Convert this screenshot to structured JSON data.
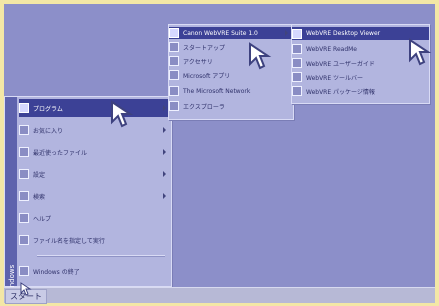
{
  "taskbar": {
    "start_label": "スタート"
  },
  "start_menu": {
    "side_label": "Windows",
    "items": [
      {
        "label": "プログラム",
        "has_arrow": true,
        "selected": true
      },
      {
        "label": "お気に入り",
        "has_arrow": true
      },
      {
        "label": "最近使ったファイル",
        "has_arrow": true
      },
      {
        "label": "設定",
        "has_arrow": true
      },
      {
        "label": "検索",
        "has_arrow": true
      },
      {
        "label": "ヘルプ",
        "has_arrow": false
      },
      {
        "label": "ファイル名を指定して実行",
        "has_arrow": false
      },
      {
        "label": "Windows の終了",
        "has_arrow": false
      }
    ]
  },
  "programs_menu": {
    "items": [
      {
        "label": "Canon WebVRE Suite 1.0",
        "selected": true
      },
      {
        "label": "スタートアップ"
      },
      {
        "label": "アクセサリ"
      },
      {
        "label": "Microsoft アプリ"
      },
      {
        "label": "The Microsoft Network"
      },
      {
        "label": "エクスプローラ"
      }
    ]
  },
  "submenu": {
    "items": [
      {
        "label": "WebVRE Desktop Viewer",
        "selected": true
      },
      {
        "label": "WebVRE ReadMe"
      },
      {
        "label": "WebVRE ユーザーガイド"
      },
      {
        "label": "WebVRE ツールバー"
      },
      {
        "label": "WebVRE パッケージ情報"
      }
    ]
  }
}
